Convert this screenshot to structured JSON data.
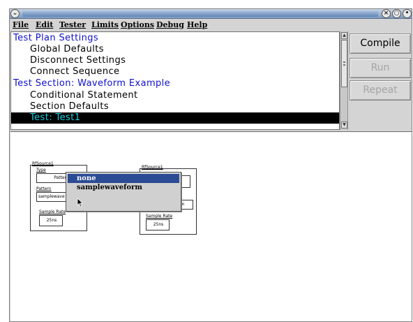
{
  "menubar": {
    "items": [
      {
        "label": "File"
      },
      {
        "label": "Edit"
      },
      {
        "label": "Tester"
      },
      {
        "label": "Limits"
      },
      {
        "label": "Options"
      },
      {
        "label": "Debug"
      },
      {
        "label": "Help"
      }
    ]
  },
  "tree": {
    "items": [
      {
        "label": "Test Plan Settings",
        "kind": "section"
      },
      {
        "label": "Global Defaults",
        "kind": "child"
      },
      {
        "label": "Disconnect Settings",
        "kind": "child"
      },
      {
        "label": "Connect Sequence",
        "kind": "child"
      },
      {
        "label": "Test Section: Waveform Example",
        "kind": "section"
      },
      {
        "label": "Conditional Statement",
        "kind": "child"
      },
      {
        "label": "Section Defaults",
        "kind": "child"
      },
      {
        "label": "Test: Test1",
        "kind": "selected"
      }
    ]
  },
  "side_buttons": {
    "compile": "Compile",
    "run": "Run",
    "repeat": "Repeat"
  },
  "canvas": {
    "block1": {
      "title": "RfSource1",
      "type_label": "Type",
      "type_value": "Pattern",
      "pattern_label": "Pattern",
      "pattern_value": "samplewave",
      "sample_rate_label": "Sample Rate",
      "sample_rate_value": "25ns"
    },
    "block2": {
      "title": "RfSource1",
      "pattern_value_tail": "rm",
      "sample_rate_label": "Sample Rate",
      "sample_rate_value": "25ns"
    }
  },
  "popup": {
    "options": [
      {
        "label": "none",
        "selected": true
      },
      {
        "label": "samplewaveform",
        "selected": false
      }
    ]
  },
  "colors": {
    "section_text": "#1010cc",
    "selected_bg": "#000000",
    "selected_text": "#1ad0dc",
    "popup_highlight": "#2b4b94",
    "titlebar": "#7c9ac0"
  },
  "icons": [
    "window-menu-icon",
    "close-icon",
    "maximize-icon",
    "minimize-icon",
    "scroll-up-icon",
    "scroll-down-icon",
    "mouse-pointer-icon"
  ]
}
